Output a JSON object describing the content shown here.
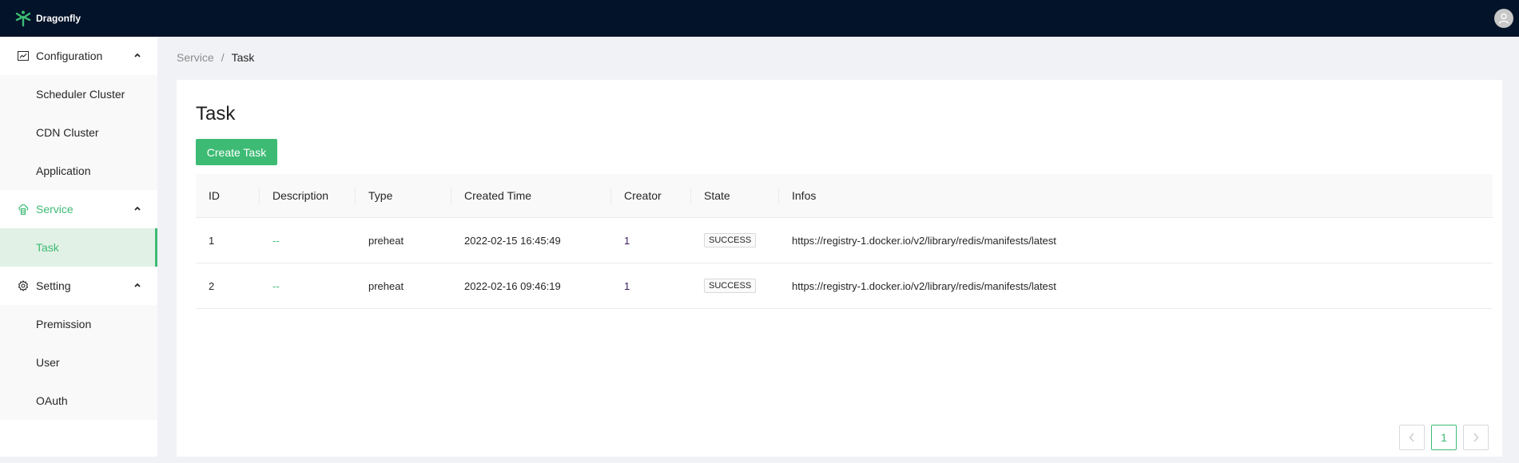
{
  "app": {
    "name": "Dragonfly",
    "logo_icon": "dragonfly-logo",
    "avatar_icon": "user-avatar-icon"
  },
  "sidebar": {
    "groups": [
      {
        "label": "Configuration",
        "icon": "line-chart-icon",
        "expanded": true,
        "active": false,
        "items": [
          {
            "label": "Scheduler Cluster",
            "selected": false
          },
          {
            "label": "CDN Cluster",
            "selected": false
          },
          {
            "label": "Application",
            "selected": false
          }
        ]
      },
      {
        "label": "Service",
        "icon": "cloud-server-icon",
        "expanded": true,
        "active": true,
        "items": [
          {
            "label": "Task",
            "selected": true
          }
        ]
      },
      {
        "label": "Setting",
        "icon": "gear-icon",
        "expanded": true,
        "active": false,
        "items": [
          {
            "label": "Premission",
            "selected": false
          },
          {
            "label": "User",
            "selected": false
          },
          {
            "label": "OAuth",
            "selected": false
          }
        ]
      }
    ]
  },
  "breadcrumb": {
    "items": [
      "Service",
      "Task"
    ],
    "separator": "/"
  },
  "main": {
    "title": "Task",
    "create_button_label": "Create Task",
    "table": {
      "columns": [
        "ID",
        "Description",
        "Type",
        "Created Time",
        "Creator",
        "State",
        "Infos"
      ],
      "rows": [
        {
          "id": "1",
          "description": "--",
          "type": "preheat",
          "created_time": "2022-02-15 16:45:49",
          "creator": "1",
          "state": "SUCCESS",
          "infos": "https://registry-1.docker.io/v2/library/redis/manifests/latest"
        },
        {
          "id": "2",
          "description": "--",
          "type": "preheat",
          "created_time": "2022-02-16 09:46:19",
          "creator": "1",
          "state": "SUCCESS",
          "infos": "https://registry-1.docker.io/v2/library/redis/manifests/latest"
        }
      ]
    },
    "pagination": {
      "prev_label": "<",
      "current_page": "1",
      "next_label": ">"
    }
  },
  "colors": {
    "accent": "#3dbb74",
    "topbar": "#031329",
    "selected_bg": "#e2f1e6"
  }
}
